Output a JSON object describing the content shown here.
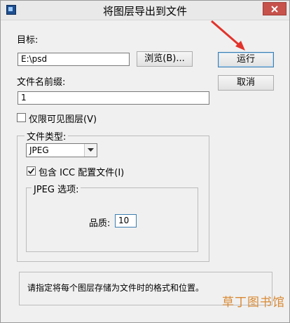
{
  "window": {
    "title": "将图层导出到文件"
  },
  "target": {
    "label": "目标:",
    "value": "E:\\psd",
    "browse_label": "浏览(B)..."
  },
  "prefix": {
    "label": "文件名前缀:",
    "value": "1"
  },
  "visible_only": {
    "label": "仅限可见图层(V)",
    "checked": false
  },
  "buttons": {
    "run": "运行",
    "cancel": "取消"
  },
  "file_type": {
    "group_title": "文件类型:",
    "selected": "JPEG",
    "icc_label": "包含 ICC 配置文件(I)",
    "icc_checked": true
  },
  "jpeg_options": {
    "group_title": "JPEG 选项:",
    "quality_label": "品质:",
    "quality_value": "10"
  },
  "note": {
    "text": "请指定将每个图层存储为文件时的格式和位置。"
  },
  "watermark": {
    "text": "草丁图书馆"
  }
}
